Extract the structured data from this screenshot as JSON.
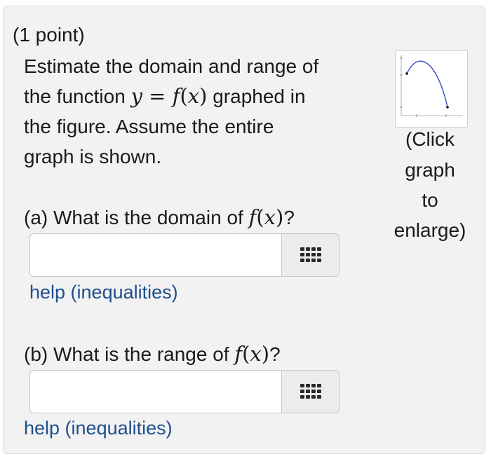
{
  "problem": {
    "points": "(1 point)",
    "statement": [
      "Estimate the domain and range of",
      "the function ",
      " graphed in",
      "the figure. Assume the entire",
      "graph is shown."
    ],
    "function_math": {
      "y": "y",
      "eq": " = ",
      "f": "f",
      "open": "(",
      "x": "x",
      "close": ")"
    }
  },
  "part_a": {
    "prefix": "(a) What is the domain of ",
    "suffix": "?",
    "input_value": "",
    "help_link": "help (inequalities)"
  },
  "part_b": {
    "prefix": "(b) What is the range of ",
    "suffix": "?",
    "input_value": "",
    "help_link": "help (inequalities)"
  },
  "figure": {
    "caption": [
      "(Click",
      "graph",
      "to",
      "enlarge)"
    ],
    "curve_color": "#2a43c2"
  },
  "icons": {
    "keyboard": "keyboard-grid-icon"
  },
  "colors": {
    "link": "#1f4e8c",
    "panel": "#f2f2f2"
  }
}
